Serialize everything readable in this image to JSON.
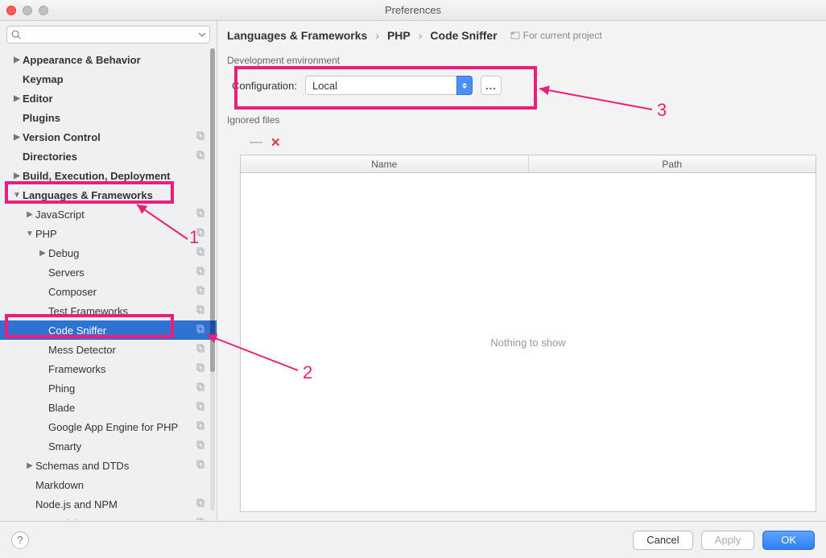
{
  "window": {
    "title": "Preferences"
  },
  "search": {
    "placeholder": ""
  },
  "sidebar": {
    "items": [
      {
        "label": "Appearance & Behavior",
        "indent": 0,
        "bold": true,
        "arrow": "right",
        "copy": false
      },
      {
        "label": "Keymap",
        "indent": 0,
        "bold": true,
        "arrow": "",
        "copy": false
      },
      {
        "label": "Editor",
        "indent": 0,
        "bold": true,
        "arrow": "right",
        "copy": false
      },
      {
        "label": "Plugins",
        "indent": 0,
        "bold": true,
        "arrow": "",
        "copy": false
      },
      {
        "label": "Version Control",
        "indent": 0,
        "bold": true,
        "arrow": "right",
        "copy": true
      },
      {
        "label": "Directories",
        "indent": 0,
        "bold": true,
        "arrow": "",
        "copy": true
      },
      {
        "label": "Build, Execution, Deployment",
        "indent": 0,
        "bold": true,
        "arrow": "right",
        "copy": false
      },
      {
        "label": "Languages & Frameworks",
        "indent": 0,
        "bold": true,
        "arrow": "down",
        "copy": false
      },
      {
        "label": "JavaScript",
        "indent": 1,
        "bold": false,
        "arrow": "right",
        "copy": true
      },
      {
        "label": "PHP",
        "indent": 1,
        "bold": false,
        "arrow": "down",
        "copy": true
      },
      {
        "label": "Debug",
        "indent": 2,
        "bold": false,
        "arrow": "right",
        "copy": true
      },
      {
        "label": "Servers",
        "indent": 2,
        "bold": false,
        "arrow": "",
        "copy": true
      },
      {
        "label": "Composer",
        "indent": 2,
        "bold": false,
        "arrow": "",
        "copy": true
      },
      {
        "label": "Test Frameworks",
        "indent": 2,
        "bold": false,
        "arrow": "",
        "copy": true
      },
      {
        "label": "Code Sniffer",
        "indent": 2,
        "bold": false,
        "arrow": "",
        "copy": true,
        "selected": true
      },
      {
        "label": "Mess Detector",
        "indent": 2,
        "bold": false,
        "arrow": "",
        "copy": true
      },
      {
        "label": "Frameworks",
        "indent": 2,
        "bold": false,
        "arrow": "",
        "copy": true
      },
      {
        "label": "Phing",
        "indent": 2,
        "bold": false,
        "arrow": "",
        "copy": true
      },
      {
        "label": "Blade",
        "indent": 2,
        "bold": false,
        "arrow": "",
        "copy": true
      },
      {
        "label": "Google App Engine for PHP",
        "indent": 2,
        "bold": false,
        "arrow": "",
        "copy": true
      },
      {
        "label": "Smarty",
        "indent": 2,
        "bold": false,
        "arrow": "",
        "copy": true
      },
      {
        "label": "Schemas and DTDs",
        "indent": 1,
        "bold": false,
        "arrow": "right",
        "copy": true
      },
      {
        "label": "Markdown",
        "indent": 1,
        "bold": false,
        "arrow": "",
        "copy": false
      },
      {
        "label": "Node.js and NPM",
        "indent": 1,
        "bold": false,
        "arrow": "",
        "copy": true
      },
      {
        "label": "SQL Dialects",
        "indent": 1,
        "bold": false,
        "arrow": "",
        "copy": true
      }
    ]
  },
  "content": {
    "breadcrumb": [
      "Languages & Frameworks",
      "PHP",
      "Code Sniffer"
    ],
    "project_scope": "For current project",
    "dev_env_title": "Development environment",
    "config_label": "Configuration:",
    "config_value": "Local",
    "dots": "...",
    "ignored_title": "Ignored files",
    "columns": [
      "Name",
      "Path"
    ],
    "empty": "Nothing to show"
  },
  "buttons": {
    "cancel": "Cancel",
    "apply": "Apply",
    "ok": "OK",
    "help": "?"
  },
  "annotations": {
    "n1": "1",
    "n2": "2",
    "n3": "3"
  }
}
